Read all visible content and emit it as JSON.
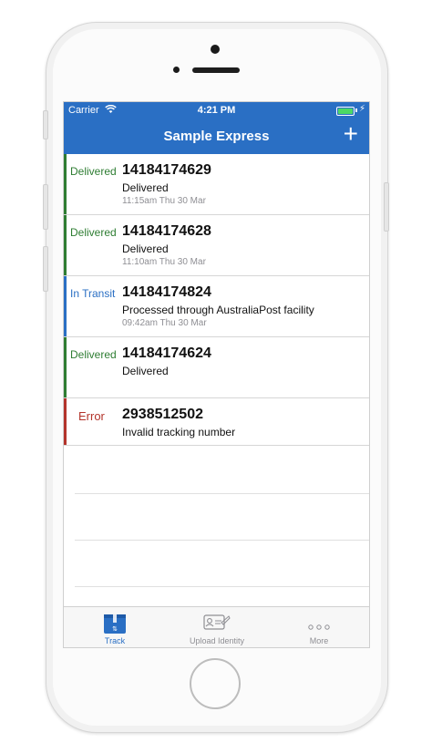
{
  "status_bar": {
    "carrier": "Carrier",
    "time": "4:21 PM"
  },
  "nav": {
    "title": "Sample Express",
    "add_label": "+"
  },
  "colors": {
    "accent": "#2a6fc4",
    "delivered": "#2e7d32",
    "in_transit": "#2a6fc4",
    "error": "#b3342b"
  },
  "shipments": [
    {
      "status": "Delivered",
      "number": "14184174629",
      "description": "Delivered",
      "timestamp": "11:15am Thu 30 Mar"
    },
    {
      "status": "Delivered",
      "number": "14184174628",
      "description": "Delivered",
      "timestamp": "11:10am Thu 30 Mar"
    },
    {
      "status": "In Transit",
      "number": "14184174824",
      "description": "Processed through AustraliaPost facility",
      "timestamp": "09:42am Thu 30 Mar"
    },
    {
      "status": "Delivered",
      "number": "14184174624",
      "description": "Delivered",
      "timestamp": ""
    },
    {
      "status": "Error",
      "number": "2938512502",
      "description": "Invalid tracking number",
      "timestamp": ""
    }
  ],
  "tabs": [
    {
      "label": "Track",
      "icon": "box-icon"
    },
    {
      "label": "Upload Identity",
      "icon": "id-card-icon"
    },
    {
      "label": "More",
      "icon": "more-dots-icon"
    }
  ]
}
